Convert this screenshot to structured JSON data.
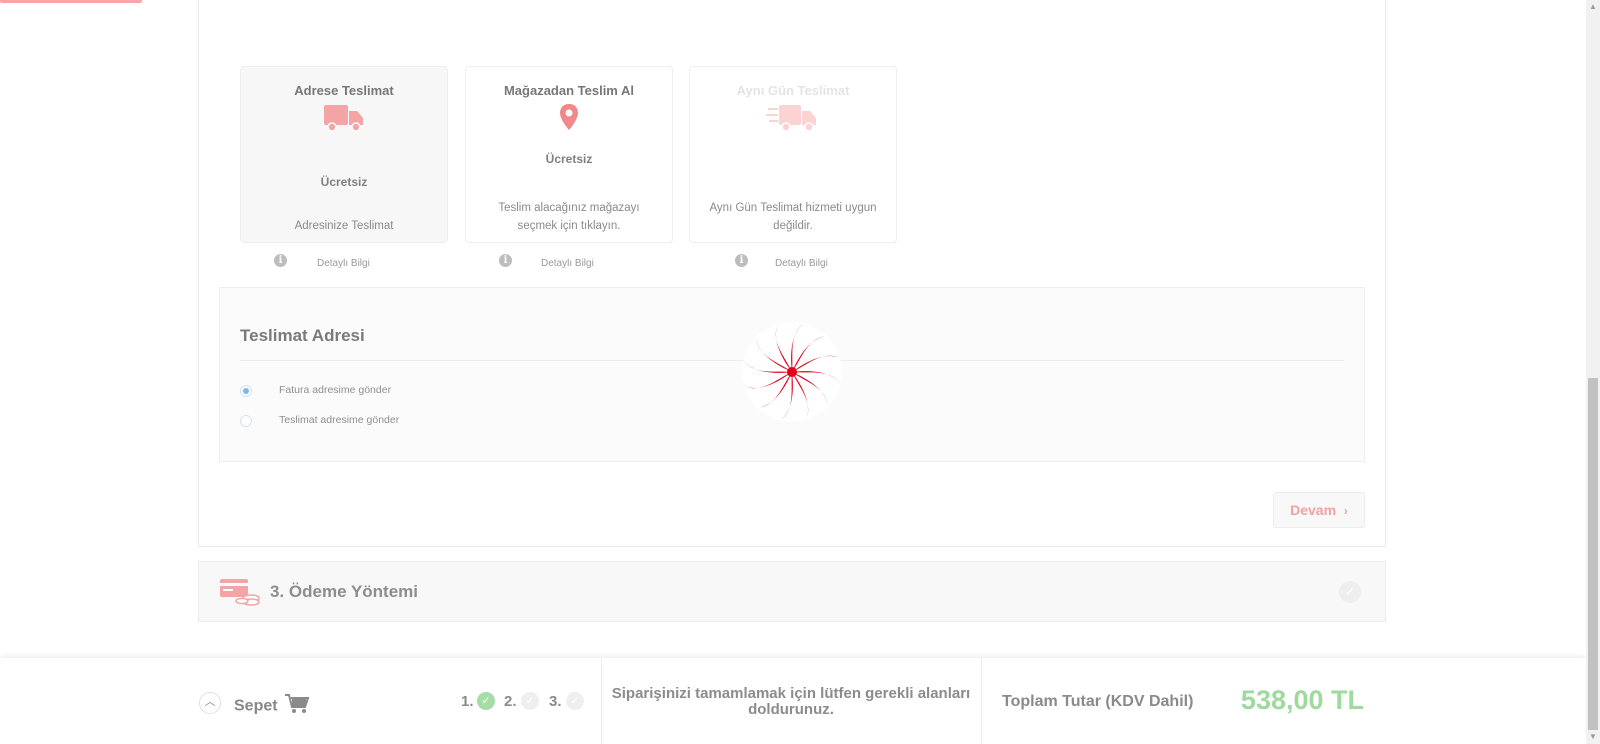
{
  "delivery_options": [
    {
      "title": "Adrese Teslimat",
      "icon": "truck-icon",
      "price": "Ücretsiz",
      "desc": "Adresinize Teslimat",
      "info": "Detaylı Bilgi"
    },
    {
      "title": "Mağazadan Teslim Al",
      "icon": "location-pin-icon",
      "price": "Ücretsiz",
      "desc": "Teslim alacağınız mağazayı seçmek için tıklayın.",
      "info": "Detaylı Bilgi"
    },
    {
      "title": "Aynı Gün Teslimat",
      "icon": "fast-truck-icon",
      "desc": "Aynı Gün Teslimat hizmeti uygun değildir.",
      "info": "Detaylı Bilgi"
    }
  ],
  "address": {
    "title": "Teslimat Adresi",
    "options": [
      {
        "label": "Fatura adresime gönder",
        "selected": true
      },
      {
        "label": "Teslimat adresime gönder",
        "selected": false
      }
    ]
  },
  "continue_label": "Devam",
  "payment": {
    "title": "3. Ödeme Yöntemi",
    "icon": "payment-icon"
  },
  "footer": {
    "cart_label": "Sepet",
    "steps": [
      {
        "label": "1.",
        "done": true
      },
      {
        "label": "2.",
        "done": false
      },
      {
        "label": "3.",
        "done": false
      }
    ],
    "message": "Siparişinizi tamamlamak için lütfen gerekli alanları doldurunuz.",
    "total_label": "Toplam Tutar (KDV Dahil)",
    "total_value": "538,00 TL"
  },
  "colors": {
    "accent": "#f4a0a0",
    "success": "#9ed99e",
    "spinner_red": "#e2001a"
  }
}
